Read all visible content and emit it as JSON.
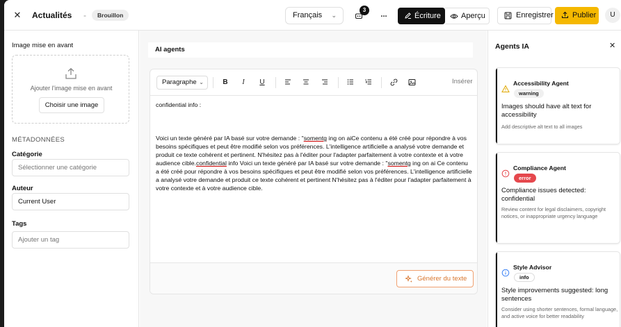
{
  "header": {
    "close_icon": "x-icon",
    "title": "Actualités",
    "separator": "-",
    "status": "Brouillon",
    "language": "Français",
    "notification_count": "3",
    "more": "...",
    "mode_write": "Écriture",
    "mode_preview": "Aperçu",
    "save": "Enregistrer",
    "publish": "Publier",
    "avatar": "U"
  },
  "left": {
    "featured_label": "Image mise en avant",
    "upload_text": "Ajouter l'image mise en avant",
    "choose_image": "Choisir une image",
    "metadata_heading": "MÉTADONNÉES",
    "category_label": "Catégorie",
    "category_placeholder": "Sélectionner une catégorie",
    "author_label": "Auteur",
    "author_value": "Current User",
    "tags_label": "Tags",
    "tags_placeholder": "Ajouter un tag"
  },
  "editor": {
    "title": "AI agents",
    "block_type": "Paragraphe",
    "insert": "Insérer",
    "line1": "confidential info :",
    "p1_a": "Voici un texte généré par IA basé sur votre demande : \"",
    "p1_u1": "somentg",
    "p1_b": " ing on aiCe contenu a été créé pour répondre à vos besoins spécifiques et peut être modifié selon vos préférences. L'intelligence artificielle a analysé votre demande et produit ce texte cohérent et pertinent. N'hésitez pas à l'éditer pour l'adapter parfaitement à votre contexte et à votre audience cible.",
    "p1_u2": "confidential",
    "p1_c": " info Voici un texte généré par IA basé sur votre demande : \"",
    "p1_u3": "somentg",
    "p1_d": " ing on ai Ce contenu a été créé pour répondre à vos besoins spécifiques et peut être modifié selon vos préférences. L'intelligence artificielle a analysé votre demande et produit ce texte cohérent et pertinent N'hésitez pas à l'éditer pour l'adapter parfaitement à votre contexte et à votre audience cible.",
    "generate": "Générer du texte"
  },
  "agents": {
    "title": "Agents IA",
    "cards": [
      {
        "name": "Accessibility Agent",
        "badge": "warning",
        "message": "Images should have alt text for accessibility",
        "detail": "Add descriptive alt text to all images",
        "icon": "warning-triangle-icon",
        "color": "#e0a800"
      },
      {
        "name": "Compliance Agent",
        "badge": "error",
        "message": "Compliance issues detected: confidential",
        "detail": "Review content for legal disclaimers, copyright notices, or inappropriate urgency language",
        "icon": "error-circle-icon",
        "color": "#e5484d"
      },
      {
        "name": "Style Advisor",
        "badge": "info",
        "message": "Style improvements suggested: long sentences",
        "detail": "Consider using shorter sentences, formal language, and active voice for better readability",
        "icon": "info-circle-icon",
        "color": "#3b82f6"
      }
    ]
  },
  "colors": {
    "accent": "#f5b800",
    "generate": "#d9772f",
    "error_badge": "#e5484d",
    "dark": "#111111"
  }
}
